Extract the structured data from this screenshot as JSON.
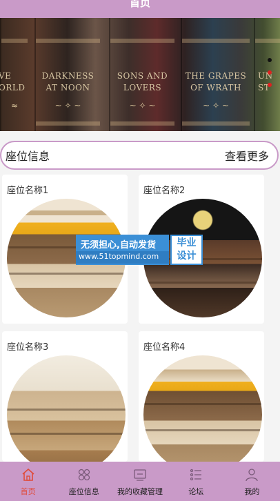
{
  "header": {
    "title": "首页"
  },
  "banner": {
    "books": [
      {
        "line1": "VE",
        "line2": "ORLD"
      },
      {
        "line1": "DARKNESS",
        "line2": "AT NOON"
      },
      {
        "line1": "SONS AND",
        "line2": "LOVERS"
      },
      {
        "line1": "THE GRAPES",
        "line2": "OF WRATH"
      },
      {
        "line1": "UN",
        "line2": "ST"
      }
    ],
    "slide_count": 3,
    "active_slide": 1
  },
  "section": {
    "title": "座位信息",
    "more_label": "查看更多"
  },
  "cards": [
    {
      "name": "座位名称1"
    },
    {
      "name": "座位名称2"
    },
    {
      "name": "座位名称3"
    },
    {
      "name": "座位名称4"
    }
  ],
  "watermark": {
    "line1": "无须担心,自动发货",
    "line2": "www.51topmind.com",
    "badge_line1": "毕业",
    "badge_line2": "设计"
  },
  "tabbar": {
    "items": [
      {
        "label": "首页",
        "icon": "home-icon",
        "active": true
      },
      {
        "label": "座位信息",
        "icon": "grid-icon",
        "active": false
      },
      {
        "label": "我的收藏管理",
        "icon": "screen-icon",
        "active": false
      },
      {
        "label": "论坛",
        "icon": "list-icon",
        "active": false
      },
      {
        "label": "我的",
        "icon": "user-icon",
        "active": false
      }
    ]
  },
  "colors": {
    "accent": "#c99ac8",
    "active_tab": "#e04b3a",
    "dot": "#e02020"
  }
}
